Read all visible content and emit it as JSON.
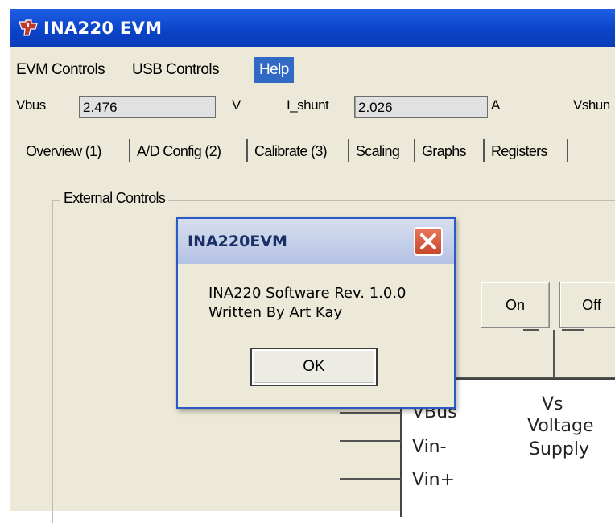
{
  "window": {
    "title": "INA220 EVM",
    "icon": "ti-logo-icon"
  },
  "menu": {
    "items": [
      "EVM Controls",
      "USB Controls",
      "Help"
    ],
    "active": "Help"
  },
  "readouts": {
    "vbus": {
      "label": "Vbus",
      "value": "2.476",
      "unit": "V"
    },
    "ishunt": {
      "label": "I_shunt",
      "value": "2.026",
      "unit": "A"
    },
    "vshunt": {
      "label": "Vshun"
    }
  },
  "tabs": [
    "Overview (1)",
    "A/D Config (2)",
    "Calibrate (3)",
    "Scaling",
    "Graphs",
    "Registers"
  ],
  "external_controls": {
    "title": "External Controls",
    "on_label": "On",
    "off_label": "Off"
  },
  "diagram": {
    "pins": [
      "VBus",
      "Vin-",
      "Vin+"
    ],
    "supply_lines": [
      "Vs",
      "Voltage",
      "Supply"
    ]
  },
  "dialog": {
    "title": "INA220EVM",
    "message_line1": "INA220 Software  Rev. 1.0.0",
    "message_line2": "Written By Art Kay",
    "ok_label": "OK",
    "close_icon": "close-icon"
  },
  "colors": {
    "titlebar": "#0a44c9",
    "menu_active": "#316ac5",
    "close_button": "#d35b3f"
  }
}
